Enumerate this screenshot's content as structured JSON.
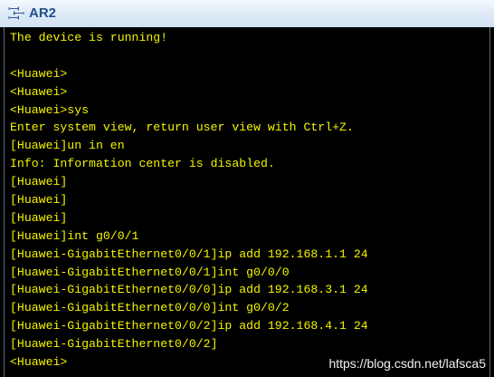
{
  "window": {
    "title": "AR2",
    "icon": "router-console-icon"
  },
  "terminal": {
    "text_color": "#f4f400",
    "background": "#000000",
    "lines": [
      "The device is running!",
      "",
      "<Huawei>",
      "<Huawei>",
      "<Huawei>sys",
      "Enter system view, return user view with Ctrl+Z.",
      "[Huawei]un in en",
      "Info: Information center is disabled.",
      "[Huawei]",
      "[Huawei]",
      "[Huawei]",
      "[Huawei]int g0/0/1",
      "[Huawei-GigabitEthernet0/0/1]ip add 192.168.1.1 24",
      "[Huawei-GigabitEthernet0/0/1]int g0/0/0",
      "[Huawei-GigabitEthernet0/0/0]ip add 192.168.3.1 24",
      "[Huawei-GigabitEthernet0/0/0]int g0/0/2",
      "[Huawei-GigabitEthernet0/0/2]ip add 192.168.4.1 24",
      "[Huawei-GigabitEthernet0/0/2]",
      "<Huawei>"
    ]
  },
  "watermark": "https://blog.csdn.net/lafsca5"
}
